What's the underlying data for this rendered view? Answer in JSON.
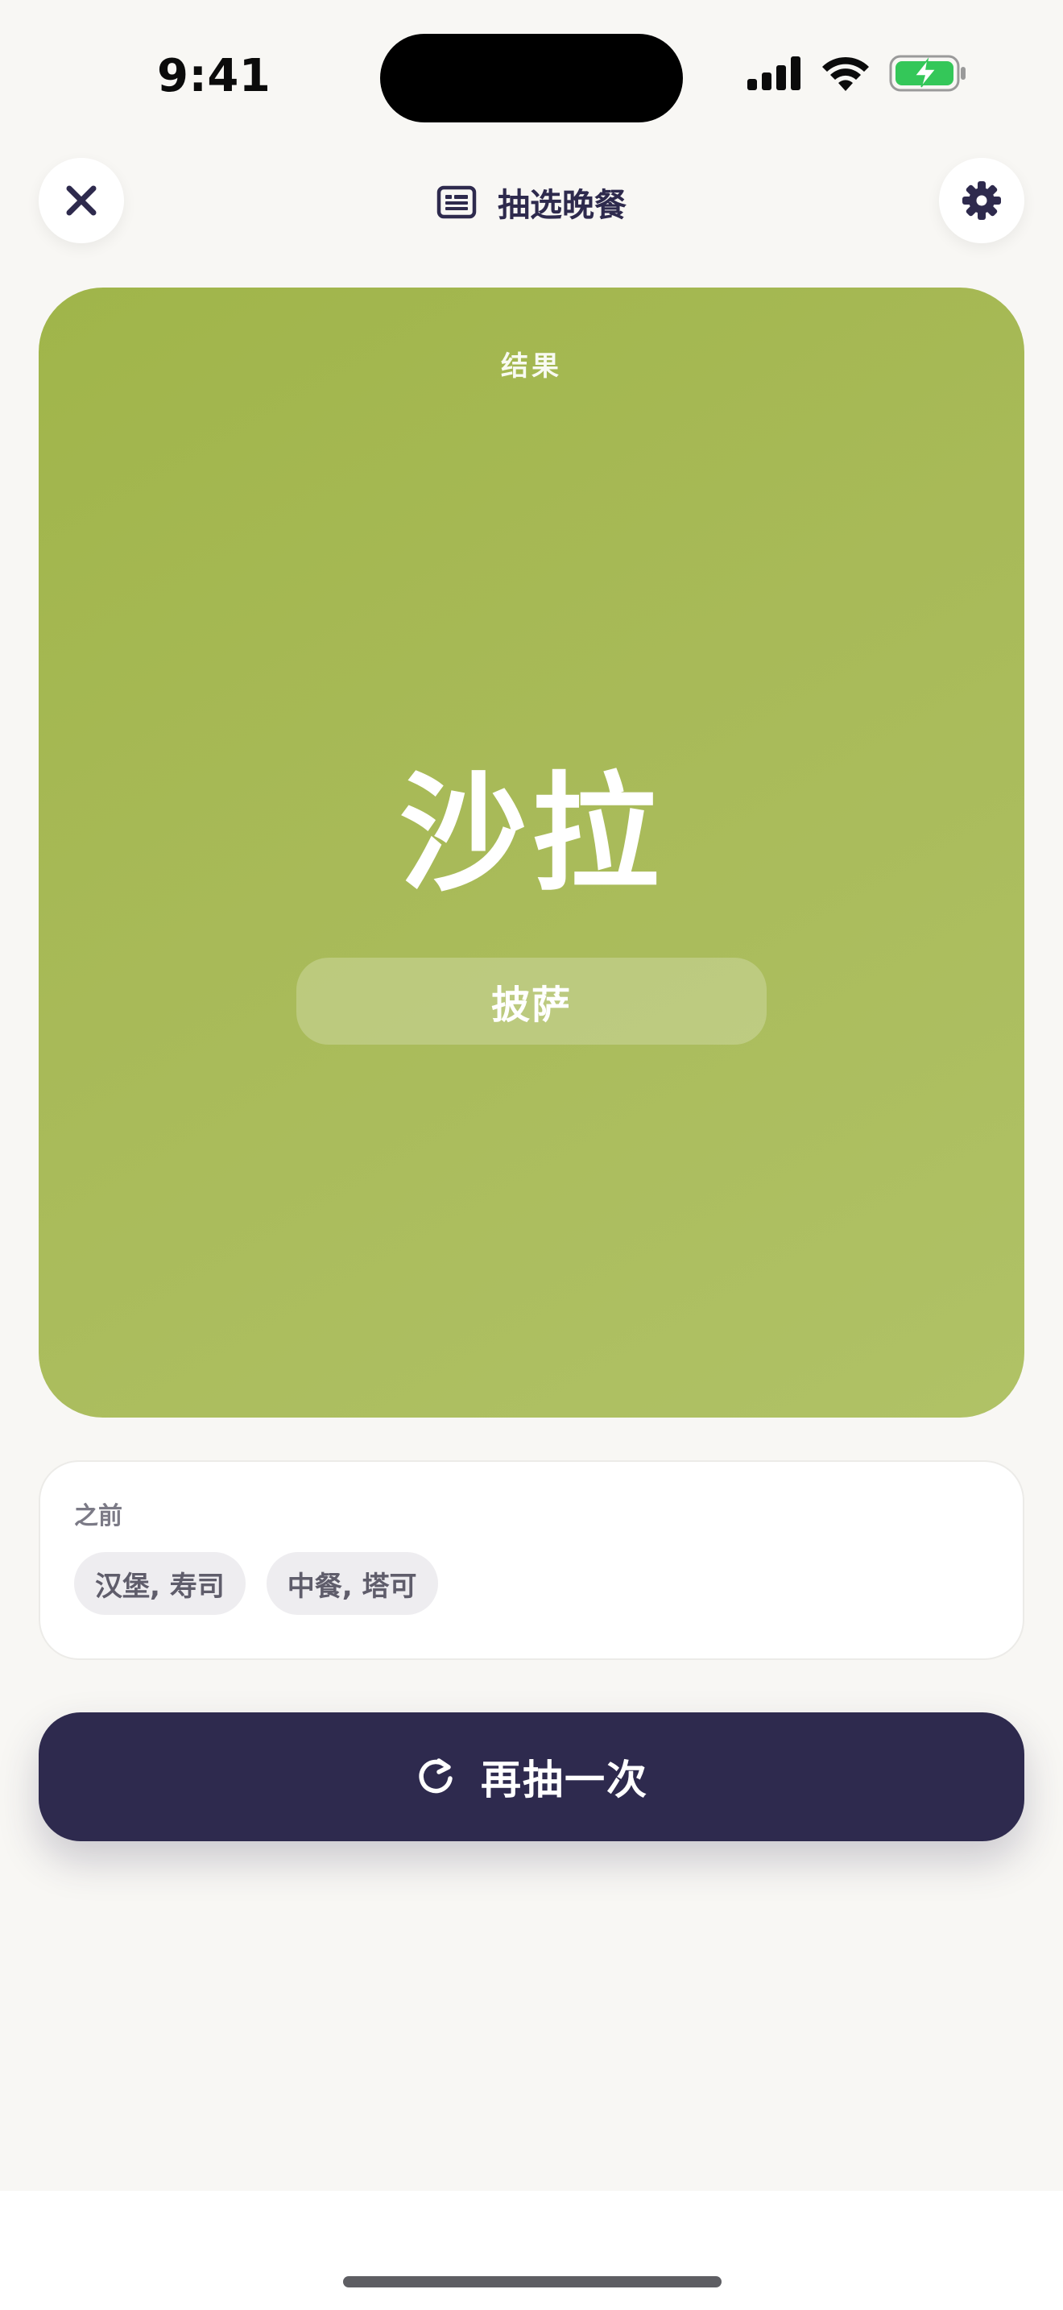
{
  "status_bar": {
    "time": "9:41"
  },
  "header": {
    "title": "抽选晚餐",
    "close_icon": "close-icon",
    "list_icon": "list-icon",
    "settings_icon": "gear-icon"
  },
  "result": {
    "label": "结果",
    "value": "沙拉",
    "alternate": "披萨",
    "colors": {
      "card_gradient_start": "#a0b54a",
      "card_gradient_end": "#b0c266"
    }
  },
  "previous": {
    "label": "之前",
    "chips": [
      "汉堡, 寿司",
      "中餐, 塔可"
    ]
  },
  "actions": {
    "redraw_label": "再抽一次",
    "redraw_icon": "refresh-icon",
    "button_color": "#2e2a4e"
  }
}
